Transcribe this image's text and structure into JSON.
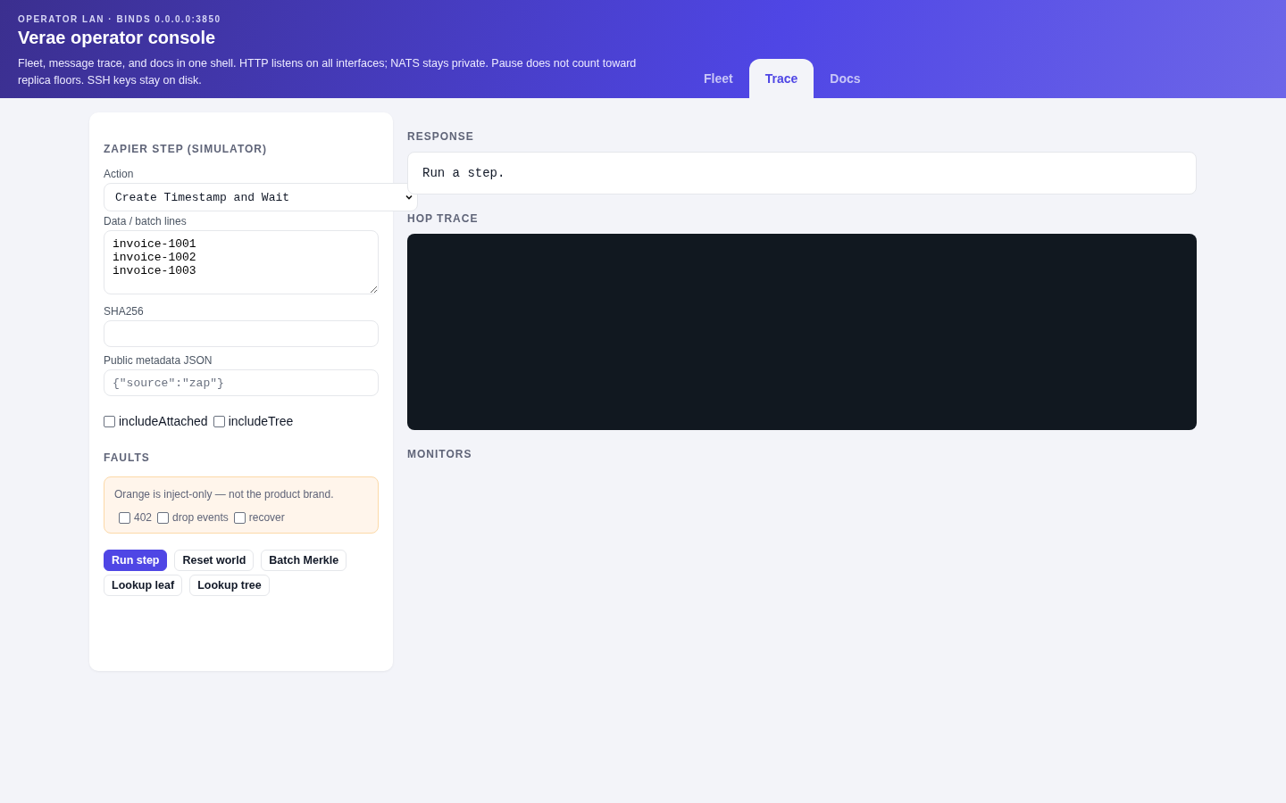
{
  "header": {
    "eyebrow": "OPERATOR LAN · BINDS 0.0.0.0:3850",
    "title": "Verae operator console",
    "description": "Fleet, message trace, and docs in one shell. HTTP listens on all interfaces; NATS stays private. Pause does not count toward replica floors. SSH keys stay on disk."
  },
  "tabs": [
    {
      "label": "Fleet",
      "selected": false
    },
    {
      "label": "Trace",
      "selected": true
    },
    {
      "label": "Docs",
      "selected": false
    }
  ],
  "form": {
    "title": "ZAPIER STEP (SIMULATOR)",
    "action": {
      "label": "Action",
      "value": "Create Timestamp and Wait"
    },
    "data": {
      "label": "Data / batch lines",
      "value": "invoice-1001\ninvoice-1002\ninvoice-1003"
    },
    "sha": {
      "label": "SHA256"
    },
    "metadata": {
      "label": "Public metadata JSON",
      "placeholder": "{\"source\":\"zap\"}"
    },
    "options": [
      {
        "label": "includeAttached",
        "checked": false
      },
      {
        "label": "includeTree",
        "checked": false
      }
    ],
    "faults": {
      "title": "FAULTS",
      "note": "Orange is inject-only — not the product brand.",
      "options": [
        {
          "label": "402",
          "checked": false
        },
        {
          "label": "drop events",
          "checked": false
        },
        {
          "label": "recover",
          "checked": false
        }
      ]
    },
    "buttons": [
      {
        "label": "Run step",
        "kind": "primary"
      },
      {
        "label": "Reset world",
        "kind": "secondary"
      },
      {
        "label": "Batch Merkle",
        "kind": "secondary"
      },
      {
        "label": "Lookup leaf",
        "kind": "secondary"
      },
      {
        "label": "Lookup tree",
        "kind": "secondary"
      }
    ]
  },
  "response": {
    "title": "RESPONSE",
    "text": "Run a step."
  },
  "hop_trace": {
    "title": "HOP TRACE"
  },
  "monitors": {
    "title": "MONITORS"
  }
}
